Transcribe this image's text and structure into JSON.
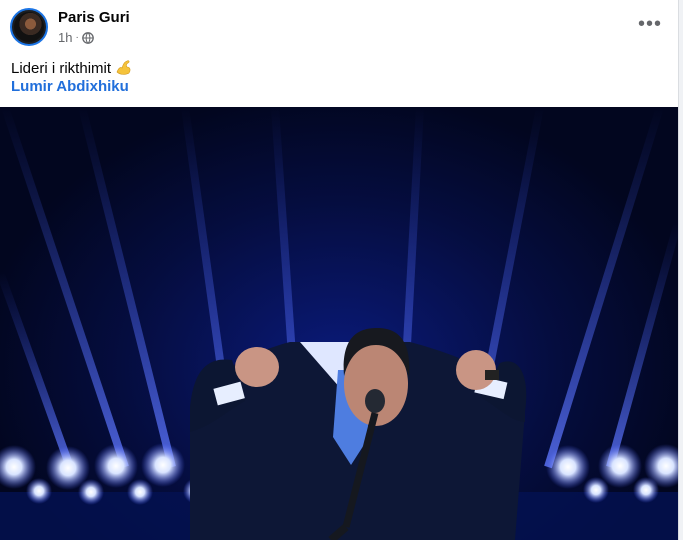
{
  "post": {
    "author": "Paris Guri",
    "time": "1h",
    "separator": "·",
    "more": "•••",
    "text": "Lideri i rikthimit",
    "emoji": "flexed-biceps",
    "mention": "Lumir Abdixhiku"
  },
  "icons": {
    "privacy": "globe-icon",
    "menu": "more-options-icon"
  },
  "colors": {
    "mention": "#216fdb",
    "secondary_text": "#65676b",
    "photo_background": "#050d3f",
    "light_beam": "#4d63ff"
  }
}
